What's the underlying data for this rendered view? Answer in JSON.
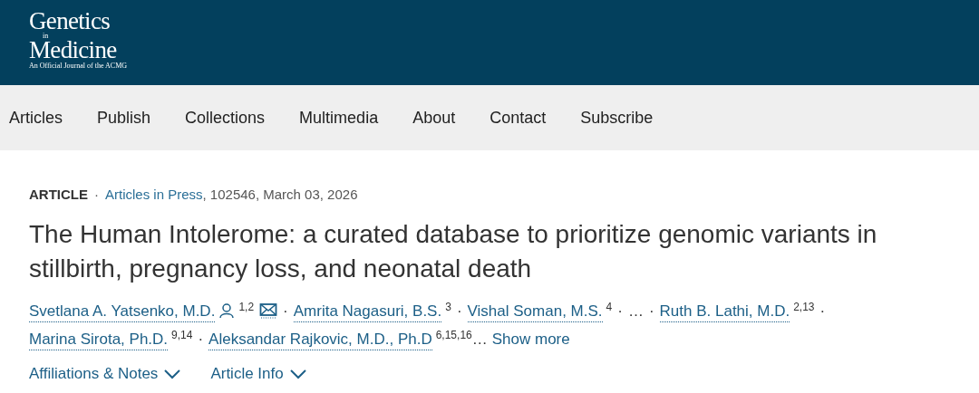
{
  "logo": {
    "line1": "Genetics",
    "small": "in",
    "line2": "Medicine",
    "tagline": "An Official Journal of the ACMG"
  },
  "nav": [
    {
      "label": "Articles"
    },
    {
      "label": "Publish"
    },
    {
      "label": "Collections"
    },
    {
      "label": "Multimedia"
    },
    {
      "label": "About"
    },
    {
      "label": "Contact"
    },
    {
      "label": "Subscribe"
    }
  ],
  "meta": {
    "type": "ARTICLE",
    "sep": "·",
    "section": "Articles in Press",
    "rest": ", 102546, March 03, 2026"
  },
  "title": "The Human Intolerome: a curated database to prioritize genomic variants in stillbirth, pregnancy loss, and neonatal death",
  "authors": [
    {
      "kind": "author",
      "name": "Svetlana A. Yatsenko, M.D.",
      "person_icon": true,
      "sup": "1,2",
      "mail_icon": true,
      "sep": "·"
    },
    {
      "kind": "author",
      "name": "Amrita Nagasuri, B.S.",
      "sup": "3",
      "sep": "·"
    },
    {
      "kind": "author",
      "name": "Vishal Soman, M.S.",
      "sup": "4",
      "sep": "·"
    },
    {
      "kind": "ellipsis",
      "text": "…",
      "sep": "·"
    },
    {
      "kind": "author",
      "name": "Ruth B. Lathi, M.D.",
      "sup": "2,13",
      "sep": "·"
    },
    {
      "kind": "author",
      "name": "Marina Sirota, Ph.D.",
      "sup": "9,14",
      "sep": "·"
    },
    {
      "kind": "author",
      "name": "Aleksandar Rajkovic, M.D., Ph.D",
      "sup": "6,15,16"
    },
    {
      "kind": "ellipsis",
      "text": "…"
    }
  ],
  "show_more": "Show more",
  "sections": [
    {
      "label": "Affiliations & Notes",
      "expanded": false
    },
    {
      "label": "Article Info",
      "expanded": false
    }
  ]
}
